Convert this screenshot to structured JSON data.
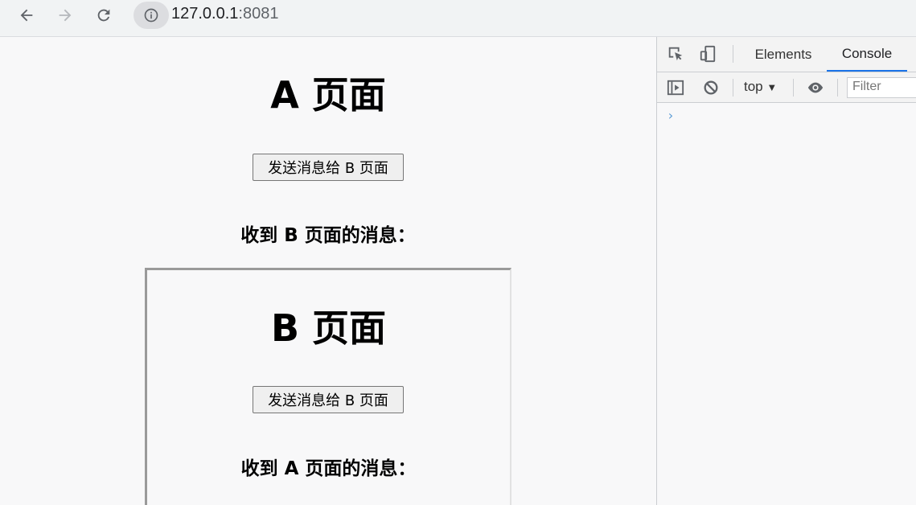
{
  "browser": {
    "url_host": "127.0.0.1",
    "url_port": ":8081",
    "icons": {
      "back": "back-arrow-icon",
      "forward": "forward-arrow-icon",
      "reload": "reload-icon",
      "site_info": "info-icon"
    }
  },
  "page_a": {
    "title": "A 页面",
    "send_button": "发送消息给 B 页面",
    "received_label": "收到 B 页面的消息："
  },
  "page_b": {
    "title": "B 页面",
    "send_button": "发送消息给 B 页面",
    "received_label": "收到 A 页面的消息："
  },
  "devtools": {
    "tabs": [
      "Elements",
      "Console"
    ],
    "active_tab": "Console",
    "context": "top",
    "filter_placeholder": "Filter",
    "prompt": "›",
    "accent_color": "#1a73e8"
  }
}
